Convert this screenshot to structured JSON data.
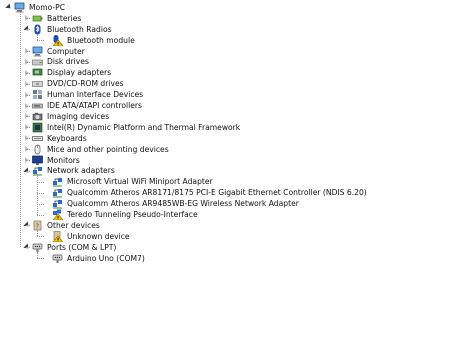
{
  "root": {
    "label": "Momo-PC",
    "icon": "computer-icon",
    "expanded": true
  },
  "categories": [
    {
      "label": "Batteries",
      "icon": "battery-icon",
      "expanded": false
    },
    {
      "label": "Bluetooth Radios",
      "icon": "bluetooth-icon",
      "expanded": true,
      "children": [
        {
          "label": "Bluetooth module",
          "icon": "bluetooth-warning-icon"
        }
      ]
    },
    {
      "label": "Computer",
      "icon": "computer-icon",
      "expanded": false
    },
    {
      "label": "Disk drives",
      "icon": "disk-drive-icon",
      "expanded": false
    },
    {
      "label": "Display adapters",
      "icon": "display-adapter-icon",
      "expanded": false
    },
    {
      "label": "DVD/CD-ROM drives",
      "icon": "dvd-drive-icon",
      "expanded": false
    },
    {
      "label": "Human Interface Devices",
      "icon": "hid-icon",
      "expanded": false
    },
    {
      "label": "IDE ATA/ATAPI controllers",
      "icon": "ide-controller-icon",
      "expanded": false
    },
    {
      "label": "Imaging devices",
      "icon": "camera-icon",
      "expanded": false
    },
    {
      "label": "Intel(R) Dynamic Platform and Thermal Framework",
      "icon": "intel-thermal-icon",
      "expanded": false
    },
    {
      "label": "Keyboards",
      "icon": "keyboard-icon",
      "expanded": false
    },
    {
      "label": "Mice and other pointing devices",
      "icon": "mouse-icon",
      "expanded": false
    },
    {
      "label": "Monitors",
      "icon": "monitor-icon",
      "expanded": false
    },
    {
      "label": "Network adapters",
      "icon": "network-adapter-icon",
      "expanded": true,
      "children": [
        {
          "label": "Microsoft Virtual WiFi Miniport Adapter",
          "icon": "network-adapter-icon"
        },
        {
          "label": "Qualcomm Atheros AR8171/8175 PCI-E Gigabit Ethernet Controller (NDIS 6.20)",
          "icon": "network-adapter-icon"
        },
        {
          "label": "Qualcomm Atheros AR9485WB-EG Wireless Network Adapter",
          "icon": "network-adapter-icon"
        },
        {
          "label": "Teredo Tunneling Pseudo-Interface",
          "icon": "network-adapter-warning-icon"
        }
      ]
    },
    {
      "label": "Other devices",
      "icon": "other-devices-icon",
      "expanded": true,
      "children": [
        {
          "label": "Unknown device",
          "icon": "unknown-device-warning-icon"
        }
      ]
    },
    {
      "label": "Ports (COM & LPT)",
      "icon": "port-icon",
      "expanded": true,
      "children": [
        {
          "label": "Arduino Uno (COM7)",
          "icon": "port-icon"
        }
      ]
    }
  ],
  "colors": {
    "accent": "#1b5fbf",
    "warning": "#f0b400",
    "text": "#111111"
  }
}
